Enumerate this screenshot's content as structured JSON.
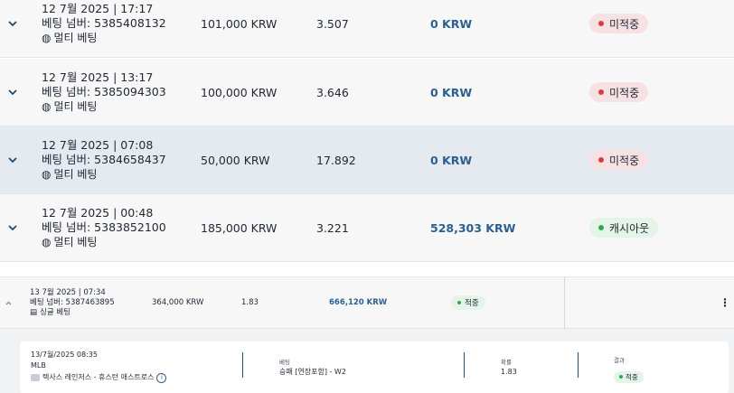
{
  "bets": [
    {
      "date": "12 7월 2025 | 17:17",
      "bet_no": "베팅 넘버: 5385408132",
      "type": "멀티 베팅",
      "stake": "101,000 KRW",
      "odds": "3.507",
      "return": "0 KRW",
      "status": "미적중",
      "status_color": "#e03b3b"
    },
    {
      "date": "12 7월 2025 | 13:17",
      "bet_no": "베팅 넘버: 5385094303",
      "type": "멀티 베팅",
      "stake": "100,000 KRW",
      "odds": "3.646",
      "return": "0 KRW",
      "status": "미적중",
      "status_color": "#e03b3b"
    },
    {
      "date": "12 7월 2025 | 07:08",
      "bet_no": "베팅 넘버: 5384658437",
      "type": "멀티 베팅",
      "stake": "50,000 KRW",
      "odds": "17.892",
      "return": "0 KRW",
      "status": "미적중",
      "status_color": "#e03b3b"
    },
    {
      "date": "12 7월 2025 | 00:48",
      "bet_no": "베팅 넘버: 5383852100",
      "type": "멀티 베팅",
      "stake": "185,000 KRW",
      "odds": "3.221",
      "return": "528,303 KRW",
      "status": "캐시아웃",
      "status_color": "#2eaa4d"
    }
  ],
  "expanded_bet": {
    "date": "13 7월 2025 | 07:34",
    "bet_no": "베팅 넘버: 5387463895",
    "type": "싱글 베팅",
    "stake": "364,000 KRW",
    "odds": "1.83",
    "return": "666,120 KRW",
    "status": "적중",
    "more_icon": "⋮",
    "detail": {
      "datetime": "13/7월/2025 08:35",
      "league": "MLB",
      "match": "텍사스 레인저스 - 휴스턴 애스트로스",
      "bet_label": "베팅",
      "bet_value": "승패 [연장포함] - W2",
      "odds_label": "확률",
      "odds_value": "1.83",
      "result_label": "결과",
      "result_value": "적중"
    }
  }
}
